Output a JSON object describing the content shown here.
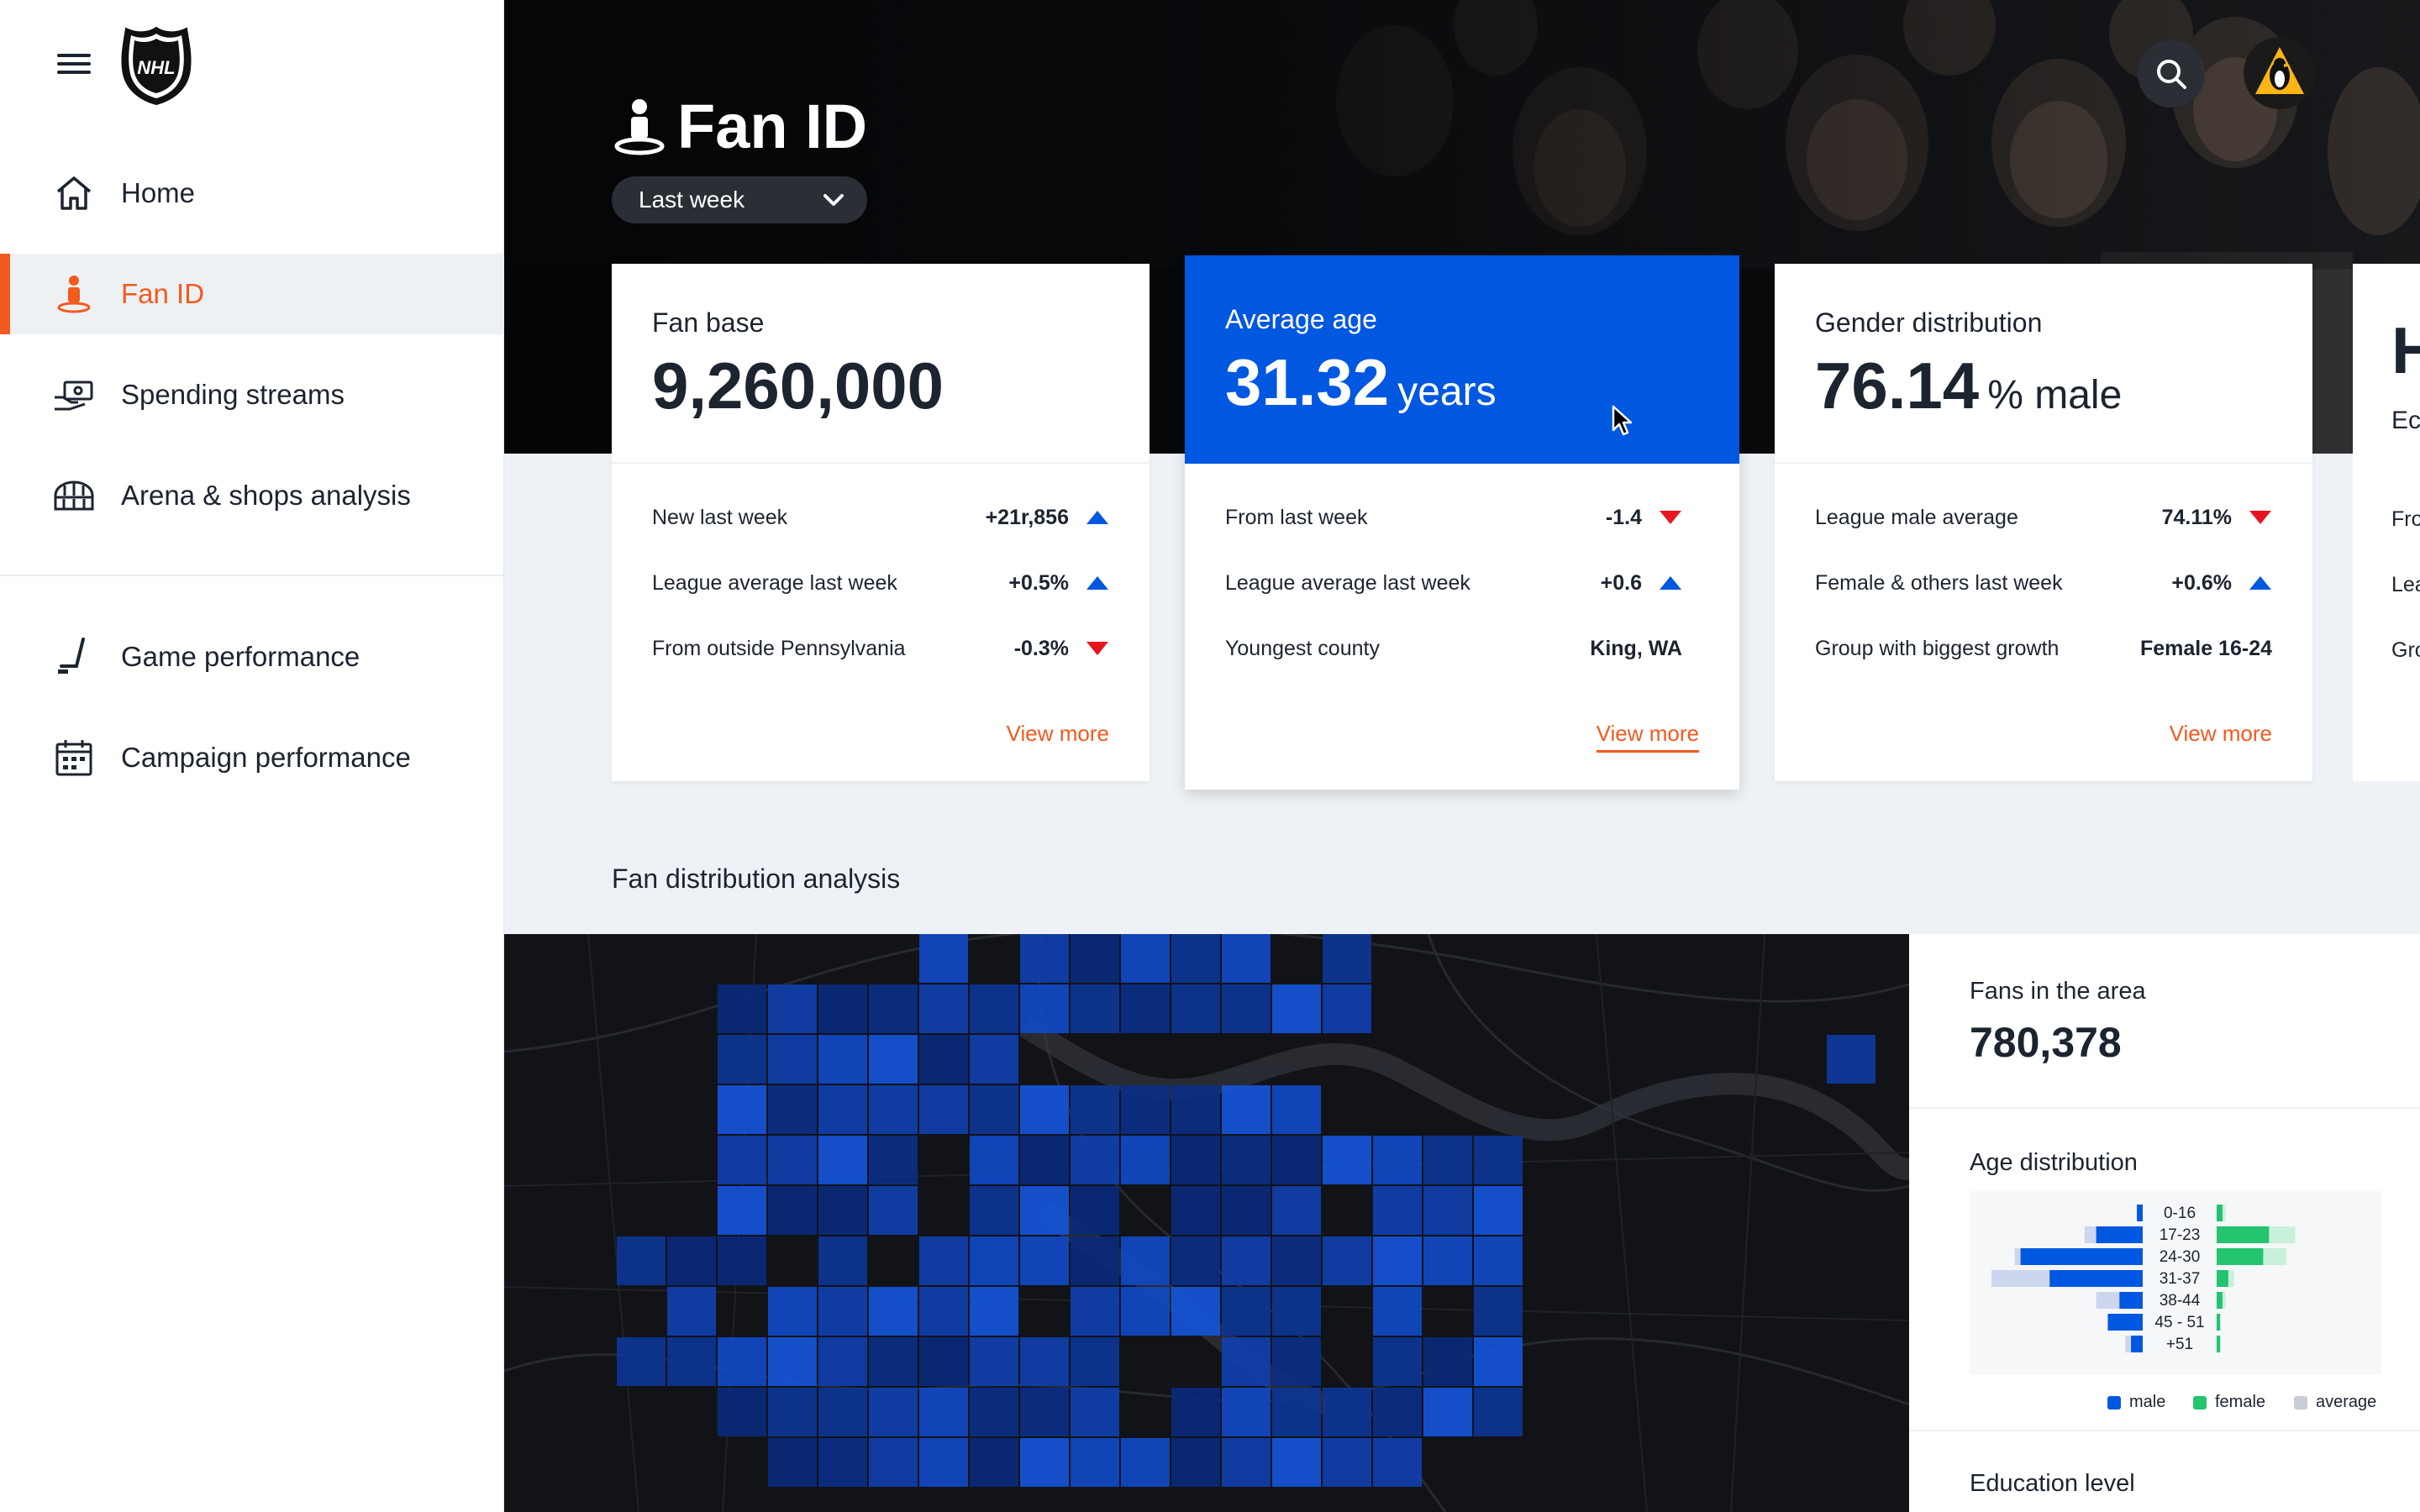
{
  "sidebar": {
    "brand": "NHL",
    "items": [
      {
        "label": "Home",
        "icon": "home-icon"
      },
      {
        "label": "Fan ID",
        "icon": "fan-id-icon",
        "active": true
      },
      {
        "label": "Spending streams",
        "icon": "spending-icon"
      },
      {
        "label": "Arena & shops analysis",
        "icon": "arena-icon"
      },
      {
        "label": "Game performance",
        "icon": "hockey-stick-icon"
      },
      {
        "label": "Campaign performance",
        "icon": "calendar-icon"
      }
    ]
  },
  "header": {
    "title": "Fan ID",
    "range": "Last week"
  },
  "cards": [
    {
      "title": "Fan base",
      "value": "9,260,000",
      "unit": "",
      "rows": [
        {
          "label": "New last week",
          "value": "+21r,856",
          "trend": "up"
        },
        {
          "label": "League average last week",
          "value": "+0.5%",
          "trend": "up"
        },
        {
          "label": "From outside Pennsylvania",
          "value": "-0.3%",
          "trend": "down"
        }
      ],
      "more": "View more"
    },
    {
      "title": "Average age",
      "value": "31.32",
      "unit": "years",
      "rows": [
        {
          "label": "From last week",
          "value": "-1.4",
          "trend": "down"
        },
        {
          "label": "League average last week",
          "value": "+0.6",
          "trend": "up"
        },
        {
          "label": "Youngest county",
          "value": "King, WA",
          "trend": ""
        }
      ],
      "more": "View more"
    },
    {
      "title": "Gender distribution",
      "value": "76.14",
      "unit": "% male",
      "rows": [
        {
          "label": "League male average",
          "value": "74.11%",
          "trend": "down"
        },
        {
          "label": "Female & others last week",
          "value": "+0.6%",
          "trend": "up"
        },
        {
          "label": "Group with biggest growth",
          "value": "Female 16-24",
          "trend": ""
        }
      ],
      "more": "View more"
    },
    {
      "title_fragment": "Ec",
      "value_fragment": "H",
      "row_fragments": [
        "Fro",
        "Lea",
        "Gro"
      ]
    }
  ],
  "section": {
    "title": "Fan distribution analysis"
  },
  "panel": {
    "fans_title": "Fans in the area",
    "fans_value": "780,378",
    "age_title": "Age distribution",
    "education_title": "Education level",
    "legend": [
      "male",
      "female",
      "average"
    ]
  },
  "colors": {
    "accent": "#f25a1e",
    "primary_blue": "#0057e0",
    "up_arrow": "#0057e0",
    "down_arrow": "#e8141e",
    "female": "#22c46e"
  },
  "chart_data": {
    "type": "bar",
    "title": "Age distribution",
    "categories": [
      "0-16",
      "17-23",
      "24-30",
      "31-37",
      "38-44",
      "45 - 51",
      "+51"
    ],
    "series": [
      {
        "name": "male",
        "values": [
          1,
          8,
          21,
          16,
          4,
          6,
          2
        ]
      },
      {
        "name": "female",
        "values": [
          1,
          9,
          8,
          2,
          1,
          0.5,
          0.5
        ]
      },
      {
        "name": "average",
        "values": [
          1,
          10,
          22,
          26,
          8,
          6,
          3
        ]
      }
    ]
  }
}
